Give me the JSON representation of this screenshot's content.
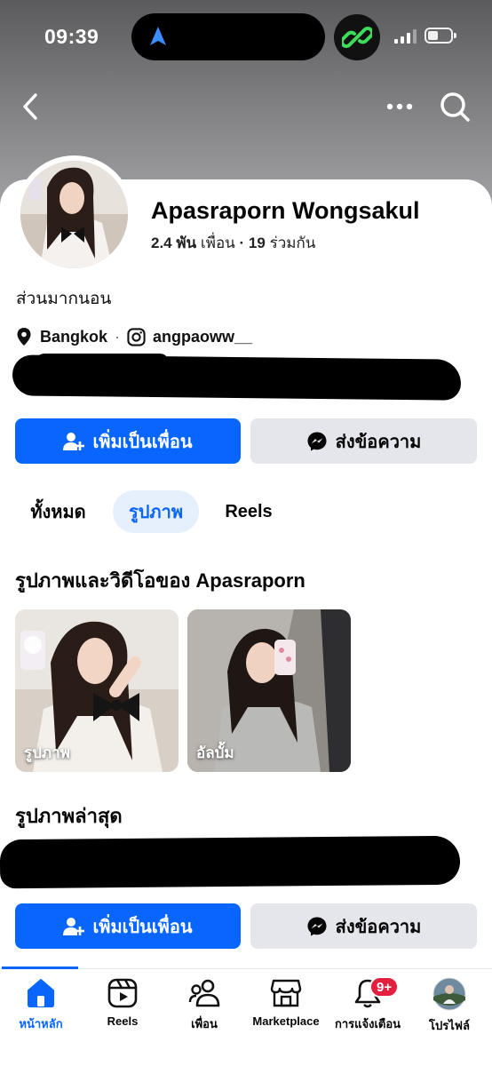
{
  "status_bar": {
    "time": "09:39"
  },
  "header": {
    "back_icon": "chevron-left-icon",
    "more_icon": "more-dots-icon",
    "search_icon": "search-icon"
  },
  "profile": {
    "name": "Apasraporn Wongsakul",
    "friends_count": "2.4 พัน",
    "friends_label": "เพื่อน",
    "separator": "·",
    "mutual_count": "19",
    "mutual_label": "ร่วมกัน",
    "bio": "ส่วนมากนอน",
    "location": "Bangkok",
    "instagram": "angpaoww__"
  },
  "actions": {
    "add_friend": "เพิ่มเป็นเพื่อน",
    "message": "ส่งข้อความ"
  },
  "tabs": [
    {
      "label": "ทั้งหมด",
      "active": false
    },
    {
      "label": "รูปภาพ",
      "active": true
    },
    {
      "label": "Reels",
      "active": false
    }
  ],
  "photos_section": {
    "title": "รูปภาพและวิดีโอของ Apasraporn",
    "tiles": [
      {
        "label": "รูปภาพ"
      },
      {
        "label": "อัลบั้ม"
      }
    ]
  },
  "recent_section": {
    "title": "รูปภาพล่าสุด"
  },
  "bottom_nav": [
    {
      "label": "หน้าหลัก",
      "icon": "home-icon",
      "active": true
    },
    {
      "label": "Reels",
      "icon": "reels-icon",
      "active": false
    },
    {
      "label": "เพื่อน",
      "icon": "friends-icon",
      "active": false
    },
    {
      "label": "Marketplace",
      "icon": "marketplace-icon",
      "active": false
    },
    {
      "label": "การแจ้งเตือน",
      "icon": "bell-icon",
      "active": false
    },
    {
      "label": "โปรไฟล์",
      "icon": "profile-avatar",
      "active": false
    }
  ],
  "notification_badge": "9+",
  "colors": {
    "accent": "#0866ff",
    "secondary_button": "#e4e6eb",
    "badge": "#e41e3f",
    "active_tab_bg": "#e6f0fd"
  }
}
